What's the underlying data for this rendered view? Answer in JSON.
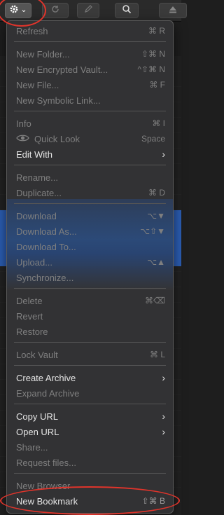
{
  "toolbar": {
    "gear_chevron": "⌄"
  },
  "menu": {
    "items": [
      {
        "label": "Refresh",
        "shortcut": "⌘ R",
        "disabled": true
      },
      {
        "label": "New Folder...",
        "shortcut": "⇧⌘ N",
        "disabled": true
      },
      {
        "label": "New Encrypted Vault...",
        "shortcut": "^⇧⌘ N",
        "disabled": true
      },
      {
        "label": "New File...",
        "shortcut": "⌘ F",
        "disabled": true
      },
      {
        "label": "New Symbolic Link...",
        "shortcut": "",
        "disabled": true
      },
      {
        "label": "Info",
        "shortcut": "⌘ I",
        "disabled": true
      },
      {
        "label": "Quick Look",
        "shortcut": "Space",
        "disabled": true
      },
      {
        "label": "Edit With",
        "shortcut": "›",
        "disabled": false
      },
      {
        "label": "Rename...",
        "shortcut": "",
        "disabled": true
      },
      {
        "label": "Duplicate...",
        "shortcut": "⌘ D",
        "disabled": true
      },
      {
        "label": "Download",
        "shortcut": "⌥▼",
        "disabled": true
      },
      {
        "label": "Download As...",
        "shortcut": "⌥⇧▼",
        "disabled": true
      },
      {
        "label": "Download To...",
        "shortcut": "",
        "disabled": true
      },
      {
        "label": "Upload...",
        "shortcut": "⌥▲",
        "disabled": true
      },
      {
        "label": "Synchronize...",
        "shortcut": "",
        "disabled": true
      },
      {
        "label": "Delete",
        "shortcut": "⌘⌫",
        "disabled": true
      },
      {
        "label": "Revert",
        "shortcut": "",
        "disabled": true
      },
      {
        "label": "Restore",
        "shortcut": "",
        "disabled": true
      },
      {
        "label": "Lock Vault",
        "shortcut": "⌘ L",
        "disabled": true
      },
      {
        "label": "Create Archive",
        "shortcut": "›",
        "disabled": false
      },
      {
        "label": "Expand Archive",
        "shortcut": "",
        "disabled": true
      },
      {
        "label": "Copy URL",
        "shortcut": "›",
        "disabled": false
      },
      {
        "label": "Open URL",
        "shortcut": "›",
        "disabled": false
      },
      {
        "label": "Share...",
        "shortcut": "",
        "disabled": true
      },
      {
        "label": "Request files...",
        "shortcut": "",
        "disabled": true
      },
      {
        "label": "New Browser",
        "shortcut": "",
        "disabled": true
      },
      {
        "label": "New Bookmark",
        "shortcut": "⇧⌘ B",
        "disabled": false
      }
    ]
  },
  "colors": {
    "menu_bg": "#343436",
    "text": "#e6e6e6",
    "disabled_text": "#7f7f7f",
    "selection_blue": "#2c5fb6",
    "annotation_red": "#e0342b"
  }
}
